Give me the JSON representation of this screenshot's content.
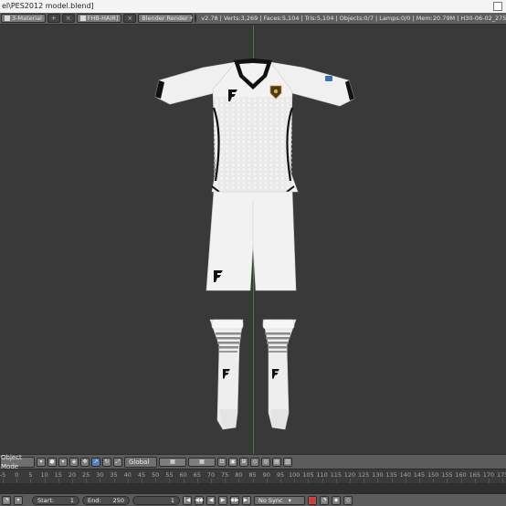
{
  "window": {
    "title": "el\\PES2012 model.blend]"
  },
  "header": {
    "material_slot": "3-Material",
    "object_name": "FHB-HAIR]",
    "render_engine": "Blender Render",
    "stats": "v2.78 | Verts:3,269 | Faces:5,104 | Tris:5,104 | Objects:0/7 | Lamps:0/0 | Mem:20.79M | H30-06-02_2753b"
  },
  "view3d": {
    "mode": "Object Mode",
    "orientation": "Global"
  },
  "timeline": {
    "ruler_labels": [
      "-5",
      "0",
      "5",
      "10",
      "15",
      "20",
      "25",
      "30",
      "35",
      "40",
      "45",
      "50",
      "55",
      "60",
      "65",
      "70",
      "75",
      "80",
      "85",
      "90",
      "95",
      "100",
      "105",
      "110",
      "115",
      "120",
      "125",
      "130",
      "135",
      "140",
      "145",
      "150",
      "155",
      "160",
      "165",
      "170",
      "175"
    ],
    "start_label": "Start:",
    "start_value": "1",
    "end_label": "End:",
    "end_value": "250",
    "current_frame": "1",
    "sync": "No Sync"
  },
  "colors": {
    "viewport_bg": "#393939",
    "kit_white": "#f2f2f2",
    "kit_trim": "#111111",
    "y_axis": "#4c8a3e",
    "x_axis": "#7a3a3a",
    "active_button": "#5680c2"
  },
  "icons": {
    "window": "window-icon",
    "scene_info": "blender-logo-icon",
    "record": "record-icon",
    "playback": [
      "jump-start-icon",
      "prev-keyframe-icon",
      "play-reverse-icon",
      "play-icon",
      "next-keyframe-icon",
      "jump-end-icon"
    ],
    "viewport_shading": "solid-sphere-icon"
  }
}
